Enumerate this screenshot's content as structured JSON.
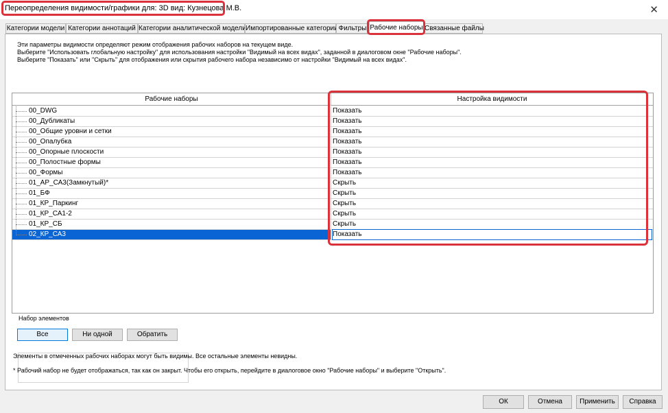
{
  "window": {
    "title": "Переопределения видимости/графики для: 3D вид: Кузнецова М.В.",
    "close_glyph": "✕"
  },
  "tabs": [
    {
      "label": "Категории модели",
      "active": false
    },
    {
      "label": "Категории аннотаций",
      "active": false
    },
    {
      "label": "Категории аналитической модели",
      "active": false
    },
    {
      "label": "Импортированные категории",
      "active": false
    },
    {
      "label": "Фильтры",
      "active": false
    },
    {
      "label": "Рабочие наборы",
      "active": true
    },
    {
      "label": "Связанные файлы",
      "active": false
    }
  ],
  "description": [
    "Эти параметры видимости определяют режим отображения рабочих наборов на текущем виде.",
    "Выберите \"Использовать глобальную настройку\" для использования настройки \"Видимый на всех видах\", заданной в диалоговом окне \"Рабочие наборы\".",
    "Выберите \"Показать\" или \"Скрыть\" для отображения или скрытия рабочего набора независимо от настройки \"Видимый на всех видах\"."
  ],
  "grid": {
    "columns": [
      "Рабочие наборы",
      "Настройка видимости"
    ],
    "rows": [
      {
        "name": "00_DWG",
        "visibility": "Показать"
      },
      {
        "name": "00_Дубликаты",
        "visibility": "Показать"
      },
      {
        "name": "00_Общие уровни и сетки",
        "visibility": "Показать"
      },
      {
        "name": "00_Опалубка",
        "visibility": "Показать"
      },
      {
        "name": "00_Опорные плоскости",
        "visibility": "Показать"
      },
      {
        "name": "00_Полостные формы",
        "visibility": "Показать"
      },
      {
        "name": "00_Формы",
        "visibility": "Показать"
      },
      {
        "name": "01_АР_СА3(Замкнутый)*",
        "visibility": "Скрыть"
      },
      {
        "name": "01_БФ",
        "visibility": "Скрыть"
      },
      {
        "name": "01_КР_Паркинг",
        "visibility": "Скрыть"
      },
      {
        "name": "01_КР_СА1-2",
        "visibility": "Скрыть"
      },
      {
        "name": "01_КР_СБ",
        "visibility": "Скрыть"
      },
      {
        "name": "02_КР_СА3",
        "visibility": "Показать",
        "selected": true
      }
    ]
  },
  "element_set": {
    "legend": "Набор элементов",
    "all_label": "Все",
    "none_label": "Ни одной",
    "invert_label": "Обратить"
  },
  "notes": {
    "visible_note": "Элементы в отмеченных рабочих наборах могут быть видимы.  Все остальные элементы невидны.",
    "closed_note": "* Рабочий набор не будет отображаться, так как он закрыт. Чтобы его открыть, перейдите в диалоговое окно \"Рабочие наборы\" и выберите \"Открыть\"."
  },
  "footer": {
    "ok_label": "ОК",
    "cancel_label": "Отмена",
    "apply_label": "Применить",
    "help_label": "Справка"
  },
  "colors": {
    "highlight": "#d9323a",
    "selection": "#0a64d4"
  }
}
